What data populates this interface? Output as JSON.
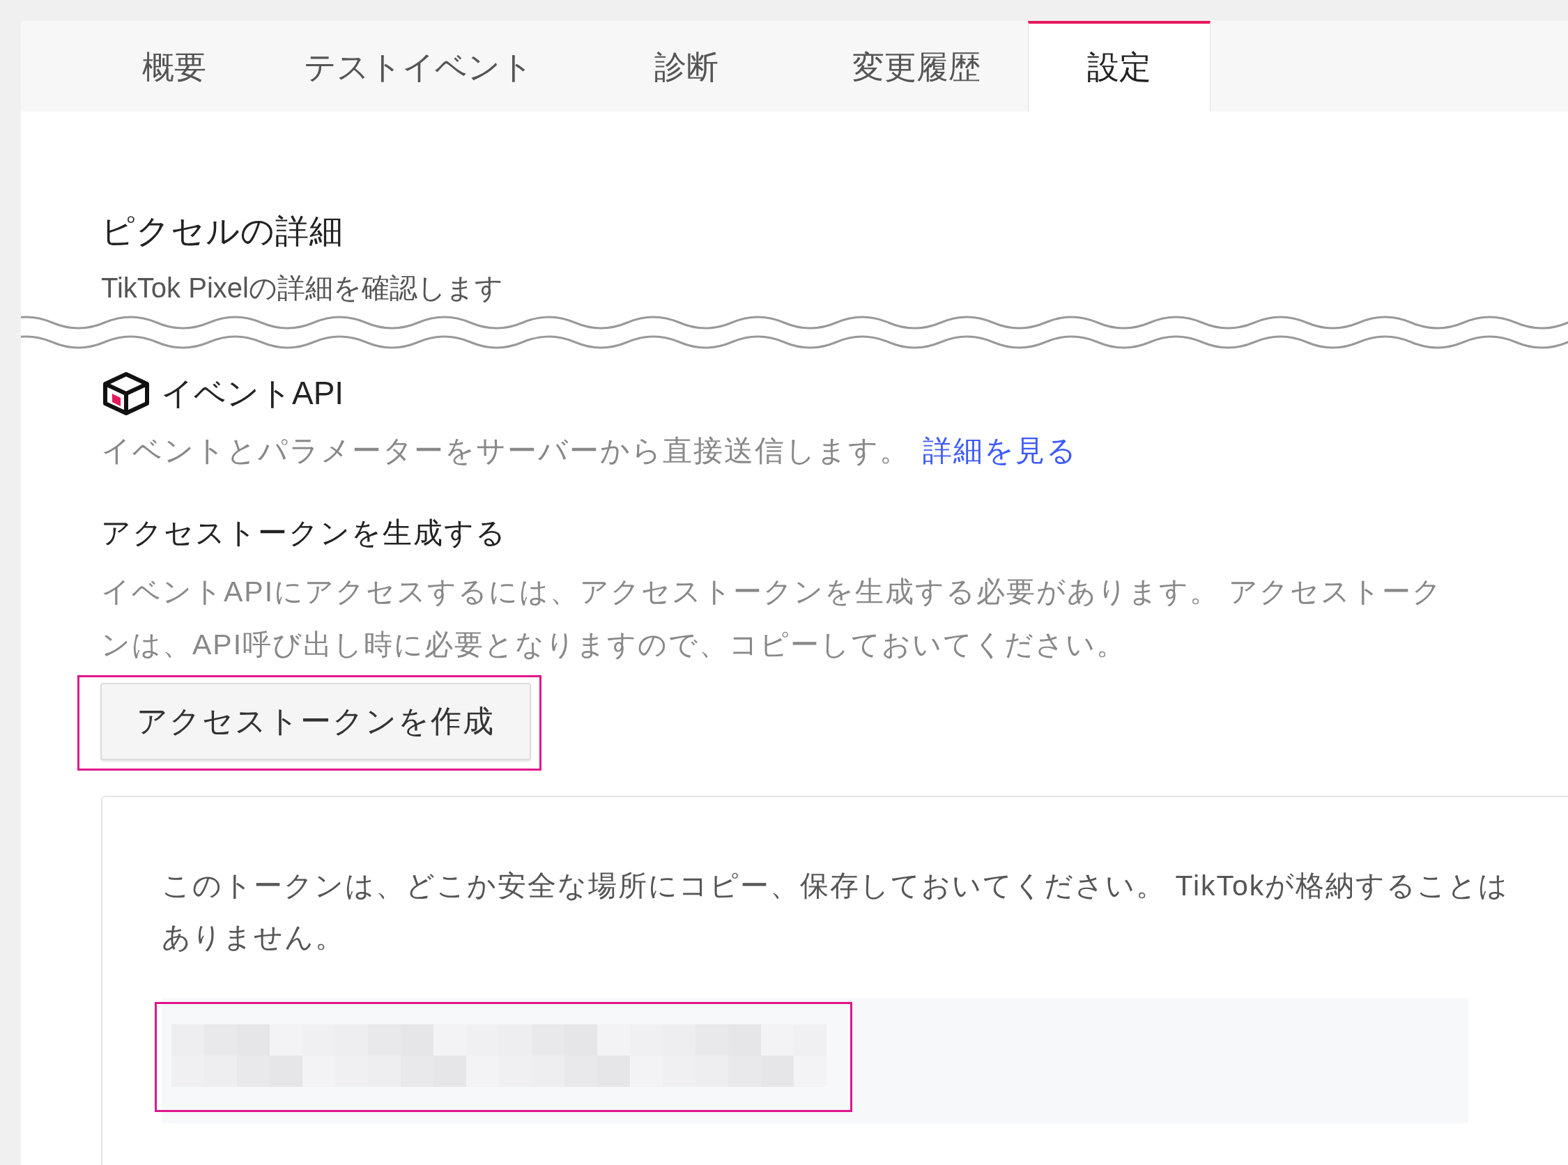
{
  "tabs": [
    {
      "label": "概要",
      "selected": false
    },
    {
      "label": "テストイベント",
      "selected": false
    },
    {
      "label": "診断",
      "selected": false
    },
    {
      "label": "変更履歴",
      "selected": false
    },
    {
      "label": "設定",
      "selected": true
    }
  ],
  "pixel_details": {
    "title": "ピクセルの詳細",
    "subtitle": "TikTok Pixelの詳細を確認します"
  },
  "events_api": {
    "title": "イベントAPI",
    "description": "イベントとパラメーターをサーバーから直接送信します。",
    "link": "詳細を見る"
  },
  "access_token": {
    "title": "アクセストークンを生成する",
    "description": "イベントAPIにアクセスするには、アクセストークンを生成する必要があります。 アクセストークンは、API呼び出し時に必要となりますので、コピーしておいてください。",
    "button": {
      "label": "アクセストークンを作成",
      "highlighted": true
    },
    "card": {
      "notice": "このトークンは、どこか安全な場所にコピー、保存しておいてください。 TikTokが格納することはありません。",
      "token_field": {
        "highlighted": true
      }
    }
  }
}
